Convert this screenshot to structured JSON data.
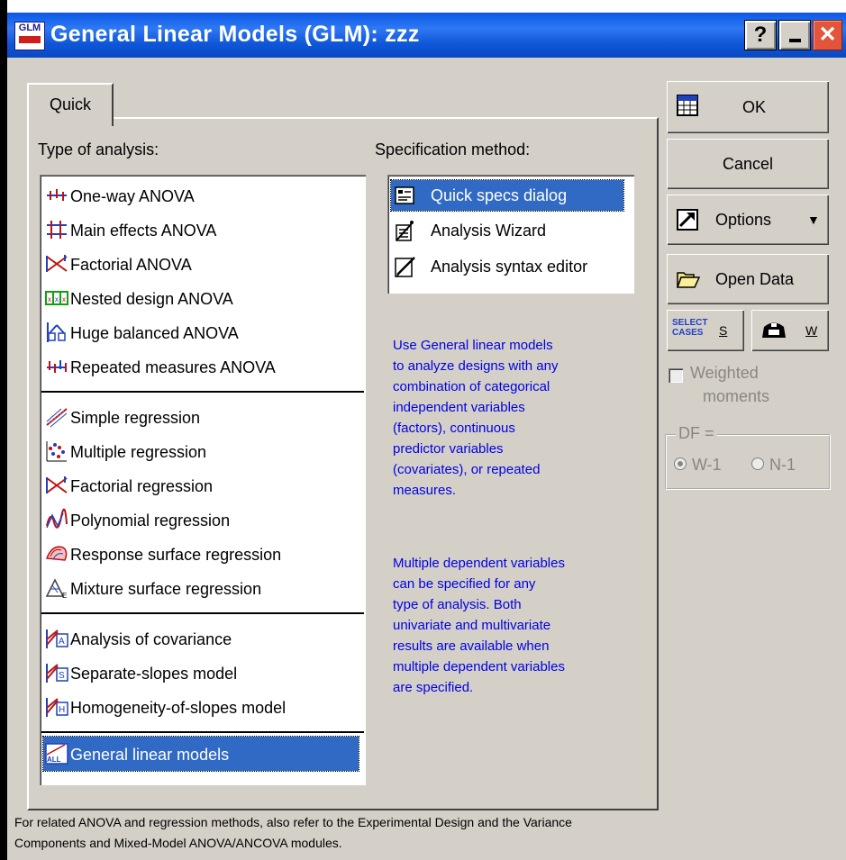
{
  "window": {
    "title": "General Linear Models (GLM): zzz",
    "app_icon_text": "GLM",
    "buttons": {
      "help": "?",
      "minimize": "_",
      "close": "✕"
    }
  },
  "tabs": [
    {
      "label": "Quick",
      "active": true
    }
  ],
  "type_of_analysis": {
    "label": "Type of analysis:",
    "items": [
      {
        "label": "One-way ANOVA",
        "icon": "one-way-anova-icon"
      },
      {
        "label": "Main effects ANOVA",
        "icon": "main-effects-anova-icon"
      },
      {
        "label": "Factorial ANOVA",
        "icon": "factorial-anova-icon"
      },
      {
        "label": "Nested design ANOVA",
        "icon": "nested-design-icon"
      },
      {
        "label": "Huge balanced ANOVA",
        "icon": "huge-balanced-icon"
      },
      {
        "label": "Repeated measures ANOVA",
        "icon": "repeated-measures-icon"
      },
      {
        "label": "Simple regression",
        "icon": "simple-regression-icon"
      },
      {
        "label": "Multiple regression",
        "icon": "multiple-regression-icon"
      },
      {
        "label": "Factorial regression",
        "icon": "factorial-regression-icon"
      },
      {
        "label": "Polynomial regression",
        "icon": "polynomial-regression-icon"
      },
      {
        "label": "Response surface regression",
        "icon": "response-surface-icon"
      },
      {
        "label": "Mixture surface regression",
        "icon": "mixture-surface-icon"
      },
      {
        "label": "Analysis of covariance",
        "icon": "ancova-icon"
      },
      {
        "label": "Separate-slopes model",
        "icon": "separate-slopes-icon"
      },
      {
        "label": "Homogeneity-of-slopes model",
        "icon": "homogeneity-slopes-icon"
      },
      {
        "label": "General linear models",
        "icon": "general-linear-models-icon",
        "selected": true
      }
    ]
  },
  "specification_method": {
    "label": "Specification method:",
    "items": [
      {
        "label": "Quick specs dialog",
        "icon": "quick-specs-icon",
        "selected": true
      },
      {
        "label": "Analysis Wizard",
        "icon": "wizard-icon"
      },
      {
        "label": "Analysis syntax editor",
        "icon": "syntax-editor-icon"
      }
    ]
  },
  "info": {
    "paragraph1": [
      "Use General linear models",
      "to analyze designs with any",
      "combination of categorical",
      "independent variables",
      "(factors), continuous",
      "predictor variables",
      "(covariates), or repeated",
      "measures."
    ],
    "paragraph2": [
      "Multiple dependent variables",
      "can be specified for any",
      "type of analysis.  Both",
      "univariate and multivariate",
      "results are available when",
      "multiple dependent variables",
      "are specified."
    ]
  },
  "side": {
    "ok": "OK",
    "cancel": "Cancel",
    "options": "Options",
    "open_data": "Open Data",
    "select_cases_icon_text": "SELECT\nCASES",
    "select_cases_key": "S",
    "weight_key": "W",
    "weighted_moments": "Weighted moments",
    "weighted_moments_line1": "Weighted",
    "weighted_moments_line2": "moments",
    "df_label": "DF =",
    "df_options": [
      {
        "label": "W-1",
        "selected": true
      },
      {
        "label": "N-1",
        "selected": false
      }
    ]
  },
  "footer": {
    "line1": "For related ANOVA and regression methods, also refer to the Experimental Design and the Variance",
    "line2": "Components and Mixed-Model ANOVA/ANCOVA modules."
  },
  "colors": {
    "title_bar": "#0a58e6",
    "selection": "#316ac5",
    "info_text": "#0000e6",
    "dialog": "#d4d0c8"
  }
}
